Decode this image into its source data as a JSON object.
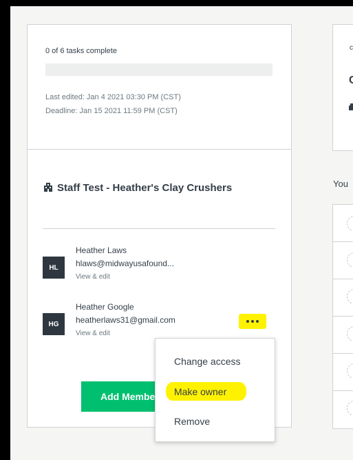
{
  "progress": {
    "text": "0 of 6 tasks complete",
    "complete": 0,
    "total": 6
  },
  "meta": {
    "last_edited": "Last edited: Jan 4 2021 03:30 PM (CST)",
    "deadline": "Deadline: Jan 15 2021 11:59 PM (CST)"
  },
  "team": {
    "icon": "building-icon",
    "title": "Staff Test - Heather's Clay Crushers"
  },
  "members": [
    {
      "initials": "HL",
      "name": "Heather Laws",
      "email": "hlaws@midwayusafound...",
      "link": "View & edit"
    },
    {
      "initials": "HG",
      "name": "Heather Google",
      "email": "heatherlaws31@gmail.com",
      "link": "View & edit"
    }
  ],
  "more_button": {
    "icon": "more-horizontal-icon",
    "highlight_color": "#fff200"
  },
  "add_button": {
    "label": "Add Members"
  },
  "context_menu": {
    "items": [
      "Change access",
      "Make owner",
      "Remove"
    ]
  },
  "right_panel": {
    "top_small": "c",
    "top_large": "C",
    "you_text": "You"
  },
  "colors": {
    "accent": "#00bf6f",
    "avatar": "#2e3740",
    "highlight": "#fff200"
  }
}
